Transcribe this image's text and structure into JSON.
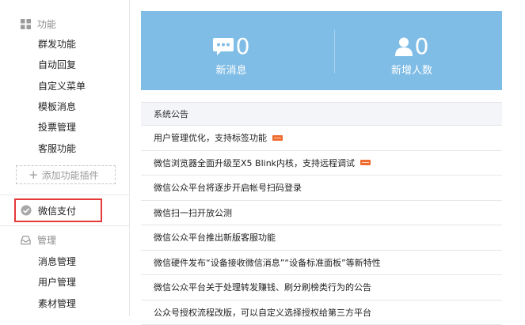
{
  "sidebar": {
    "function_section": {
      "title": "功能",
      "items": [
        "群发功能",
        "自动回复",
        "自定义菜单",
        "模板消息",
        "投票管理",
        "客服功能"
      ],
      "add_plugin": "添加功能插件"
    },
    "payment": {
      "label": "微信支付"
    },
    "manage_section": {
      "title": "管理",
      "items": [
        "消息管理",
        "用户管理",
        "素材管理"
      ]
    }
  },
  "stats": {
    "messages": {
      "value": "0",
      "label": "新消息"
    },
    "followers": {
      "value": "0",
      "label": "新增人数"
    }
  },
  "notices": {
    "title": "系统公告",
    "items": [
      {
        "text": "用户管理优化，支持标签功能",
        "is_new": true
      },
      {
        "text": "微信浏览器全面升级至X5 Blink内核，支持远程调试",
        "is_new": true
      },
      {
        "text": "微信公众平台将逐步开启帐号扫码登录",
        "is_new": false
      },
      {
        "text": "微信扫一扫开放公测",
        "is_new": false
      },
      {
        "text": "微信公众平台推出新版客服功能",
        "is_new": false
      },
      {
        "text": "微信硬件发布“设备接收微信消息”“设备标准面板”等新特性",
        "is_new": false
      },
      {
        "text": "微信公众平台关于处理转发赚钱、刷分刷榜类行为的公告",
        "is_new": false
      },
      {
        "text": "公众号授权流程改版，可以自定义选择授权给第三方平台",
        "is_new": false
      }
    ]
  },
  "colors": {
    "banner": "#80bde6",
    "highlight_border": "#e63838",
    "new_badge": "#f06b2e"
  },
  "icons": {
    "function": "grid-icon",
    "payment": "wallet-icon",
    "manage": "tray-icon",
    "messages": "chat-bubble-icon",
    "followers": "person-icon"
  }
}
